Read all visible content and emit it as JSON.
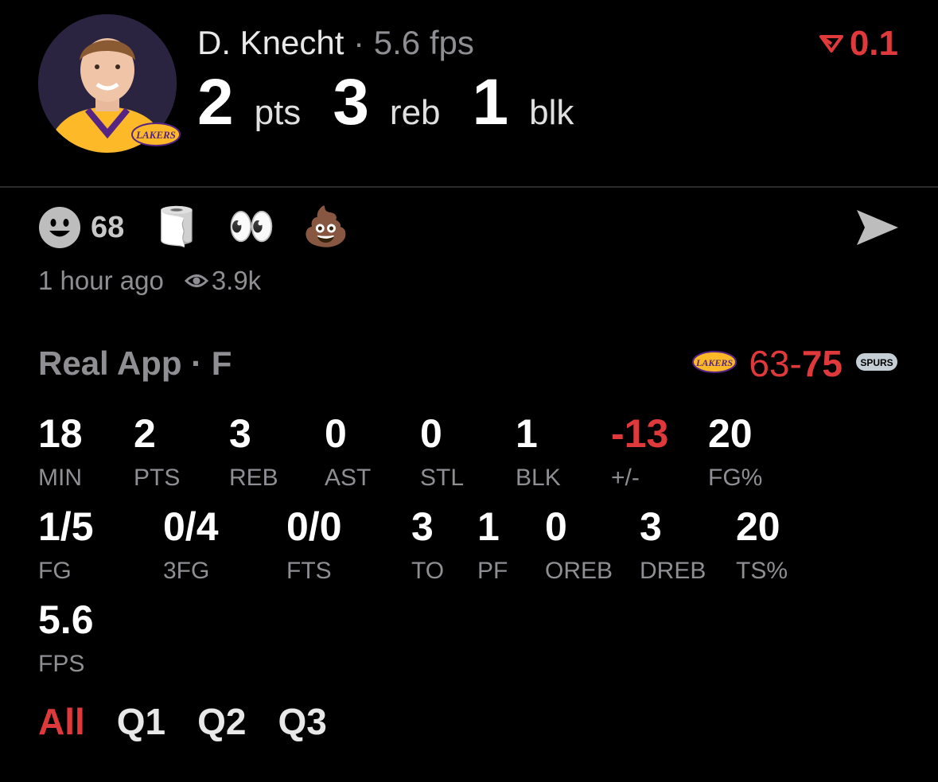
{
  "player": {
    "name": "D. Knecht",
    "separator": "·",
    "fps": "5.6 fps",
    "delta": "0.1",
    "avatar_icon": "player-photo-icon",
    "team_badge_text": "LAKERS"
  },
  "headline_stats": [
    {
      "value": "2",
      "unit": "pts"
    },
    {
      "value": "3",
      "unit": "reb"
    },
    {
      "value": "1",
      "unit": "blk"
    }
  ],
  "reactions": {
    "smile_count": "68",
    "items": [
      {
        "name": "toilet-paper-icon",
        "glyph": "🧻"
      },
      {
        "name": "eyes-icon",
        "glyph": "👀"
      },
      {
        "name": "poop-icon",
        "glyph": "💩"
      }
    ]
  },
  "meta": {
    "time": "1 hour ago",
    "views": "3.9k"
  },
  "game": {
    "source": "Real App · F",
    "home_logo": "LAKERS",
    "score_home": "63",
    "score_sep": "-",
    "score_away": "75",
    "away_logo": "SPURS"
  },
  "stats_row1": [
    {
      "value": "18",
      "label": "MIN"
    },
    {
      "value": "2",
      "label": "PTS"
    },
    {
      "value": "3",
      "label": "REB"
    },
    {
      "value": "0",
      "label": "AST"
    },
    {
      "value": "0",
      "label": "STL"
    },
    {
      "value": "1",
      "label": "BLK"
    },
    {
      "value": "-13",
      "label": "+/-"
    },
    {
      "value": "20",
      "label": "FG%"
    }
  ],
  "stats_row2": [
    {
      "value": "1/5",
      "label": "FG"
    },
    {
      "value": "0/4",
      "label": "3FG"
    },
    {
      "value": "0/0",
      "label": "FTS"
    },
    {
      "value": "3",
      "label": "TO"
    },
    {
      "value": "1",
      "label": "PF"
    },
    {
      "value": "0",
      "label": "OREB"
    },
    {
      "value": "3",
      "label": "DREB"
    },
    {
      "value": "20",
      "label": "TS%"
    }
  ],
  "stats_row3": [
    {
      "value": "5.6",
      "label": "FPS"
    }
  ],
  "tabs": [
    "All",
    "Q1",
    "Q2",
    "Q3"
  ],
  "colors": {
    "accent": "#e0393b",
    "muted": "#8e8e93",
    "lakers_purple": "#552583",
    "lakers_gold": "#fdb927"
  }
}
